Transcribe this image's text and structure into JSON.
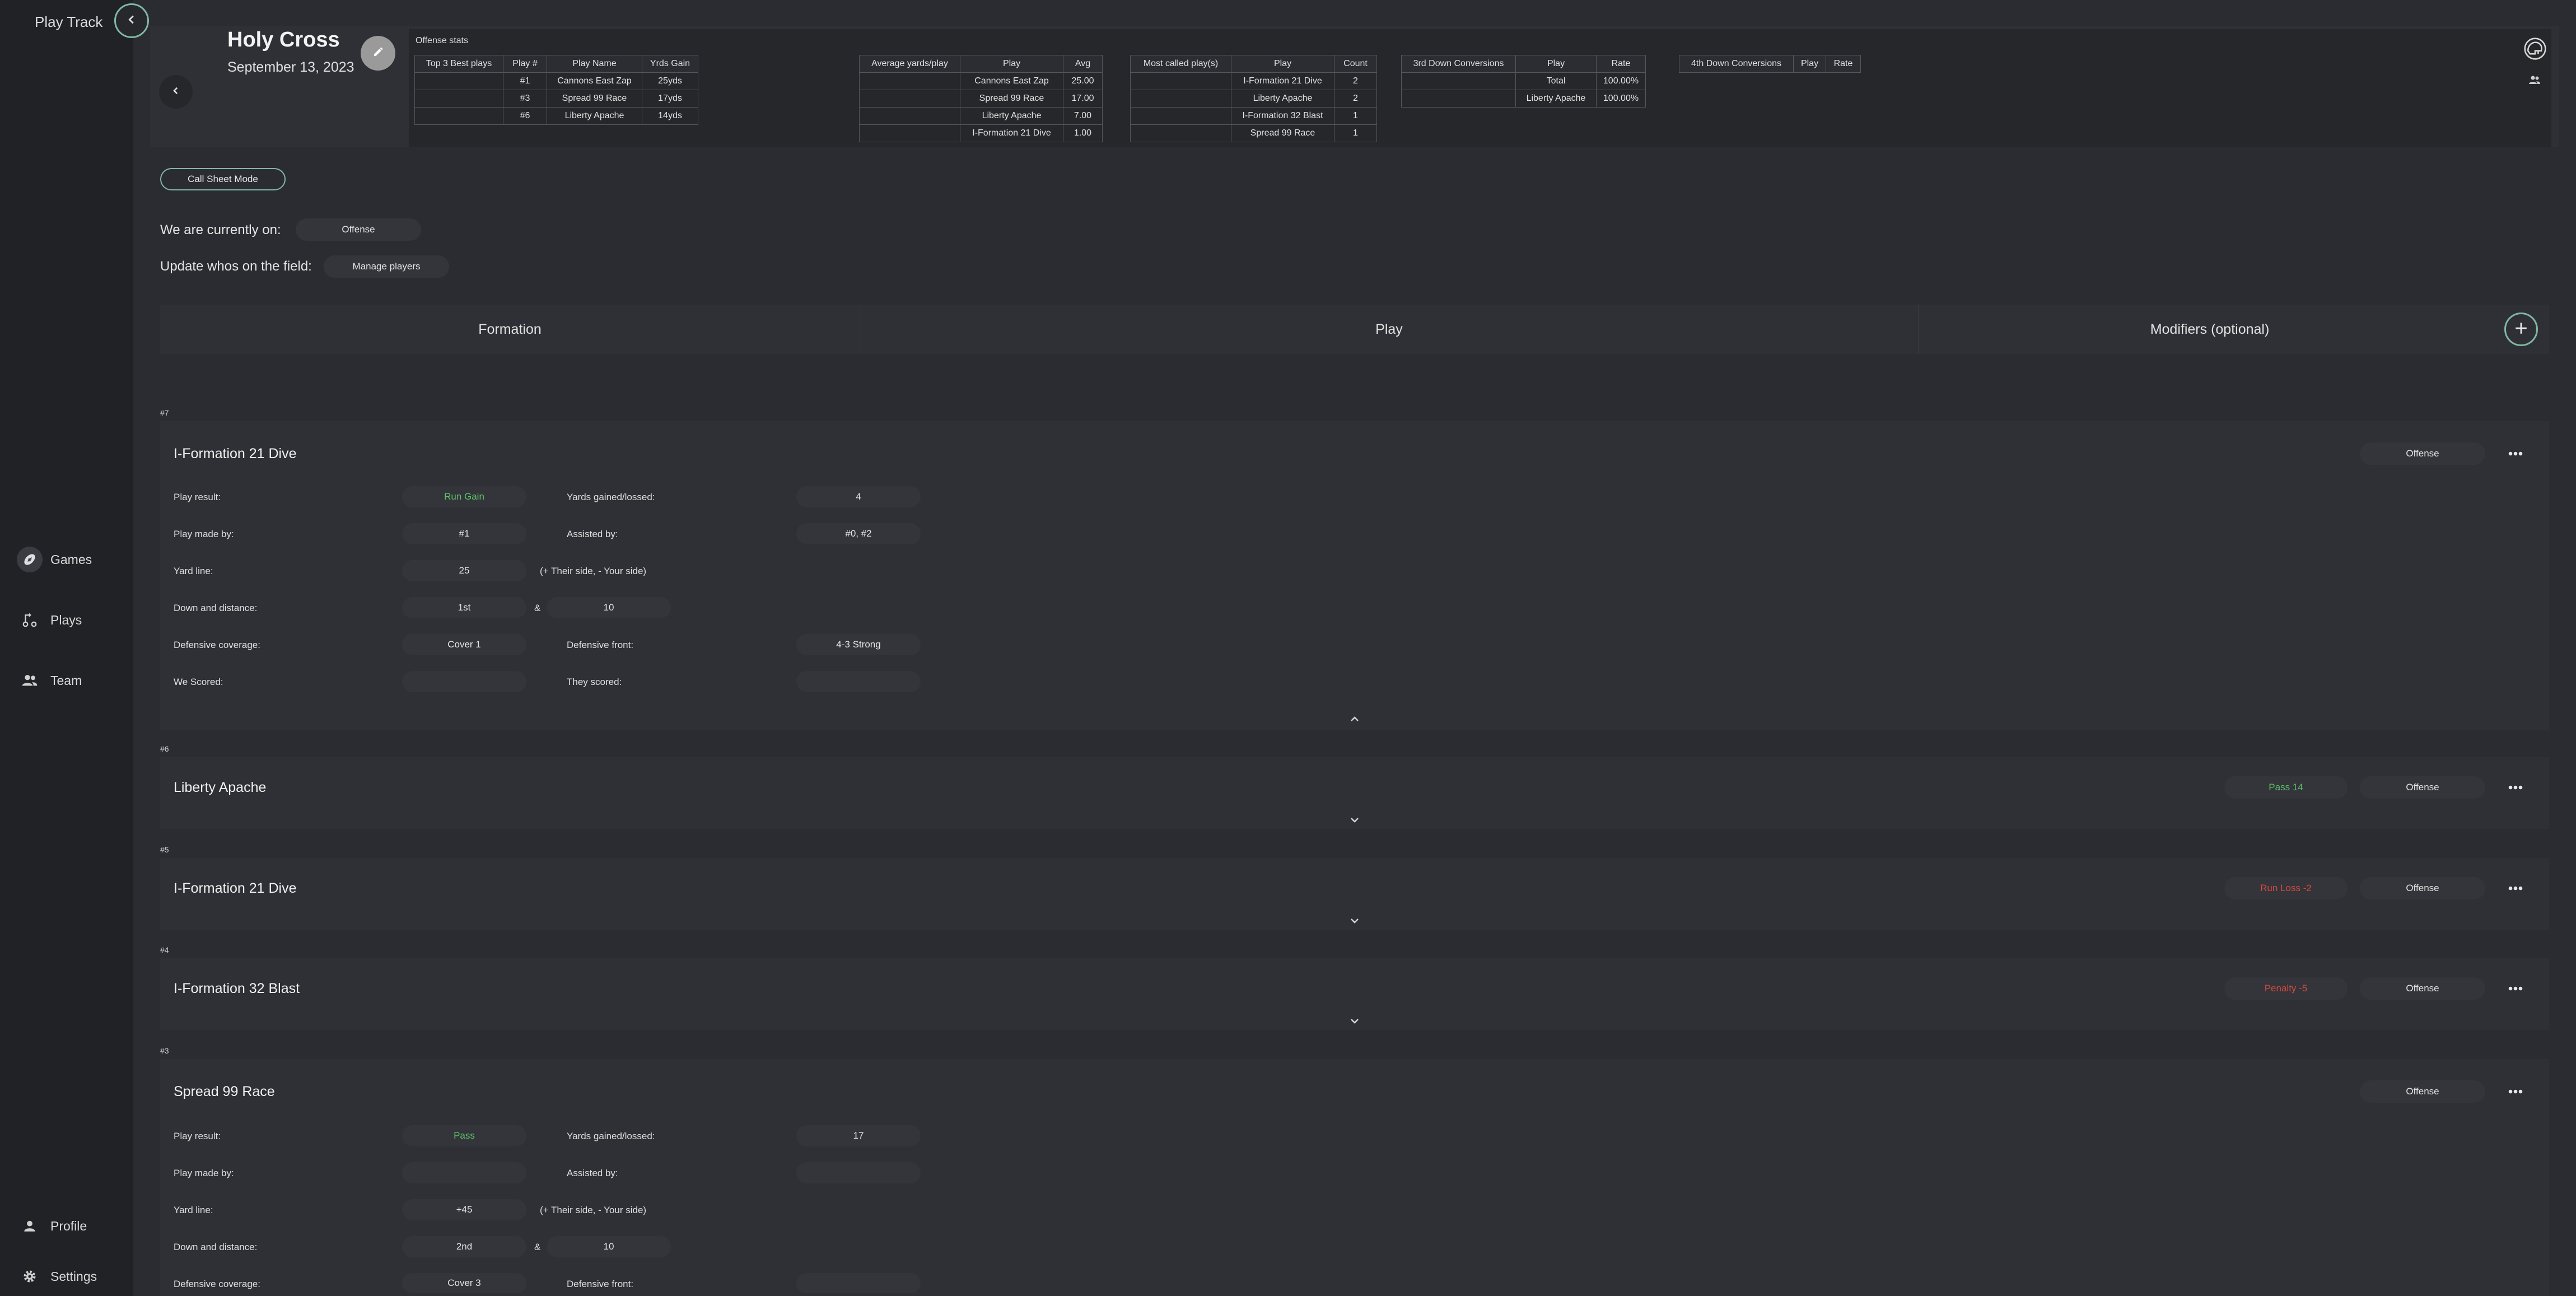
{
  "app": {
    "title": "Play Track"
  },
  "nav": {
    "games": "Games",
    "plays": "Plays",
    "team": "Team",
    "profile": "Profile",
    "settings": "Settings"
  },
  "game": {
    "title": "Holy Cross",
    "date": "September 13, 2023"
  },
  "stats": {
    "title": "Offense stats",
    "top3": {
      "headers": [
        "Top 3 Best plays",
        "Play #",
        "Play Name",
        "Yrds Gain"
      ],
      "rows": [
        [
          "",
          "#1",
          "Cannons East Zap",
          "25yds"
        ],
        [
          "",
          "#3",
          "Spread 99 Race",
          "17yds"
        ],
        [
          "",
          "#6",
          "Liberty Apache",
          "14yds"
        ]
      ]
    },
    "avg": {
      "headers": [
        "Average yards/play",
        "Play",
        "Avg"
      ],
      "rows": [
        [
          "",
          "Cannons East Zap",
          "25.00"
        ],
        [
          "",
          "Spread 99 Race",
          "17.00"
        ],
        [
          "",
          "Liberty Apache",
          "7.00"
        ],
        [
          "",
          "I-Formation 21 Dive",
          "1.00"
        ]
      ]
    },
    "most": {
      "headers": [
        "Most called play(s)",
        "Play",
        "Count"
      ],
      "rows": [
        [
          "",
          "I-Formation 21 Dive",
          "2"
        ],
        [
          "",
          "Liberty Apache",
          "2"
        ],
        [
          "",
          "I-Formation 32 Blast",
          "1"
        ],
        [
          "",
          "Spread 99 Race",
          "1"
        ]
      ]
    },
    "third": {
      "headers": [
        "3rd Down Conversions",
        "Play",
        "Rate"
      ],
      "rows": [
        [
          "",
          "Total",
          "100.00%"
        ],
        [
          "",
          "Liberty Apache",
          "100.00%"
        ]
      ]
    },
    "fourth": {
      "headers": [
        "4th Down Conversions",
        "Play",
        "Rate"
      ]
    }
  },
  "controls": {
    "call_sheet": "Call Sheet Mode",
    "currently_on_label": "We are currently on:",
    "currently_on_value": "Offense",
    "field_label": "Update whos on the field:",
    "manage_players": "Manage players"
  },
  "selector": {
    "formation": "Formation",
    "play": "Play",
    "modifiers": "Modifiers (optional)"
  },
  "labels": {
    "play_result": "Play result:",
    "yards": "Yards gained/lossed:",
    "made_by": "Play made by:",
    "assisted_by": "Assisted by:",
    "yard_line": "Yard line:",
    "yard_hint": "(+ Their side, - Your side)",
    "down_distance": "Down and distance:",
    "amp": "&",
    "coverage": "Defensive coverage:",
    "front": "Defensive front:",
    "we_scored": "We Scored:",
    "they_scored": "They scored:"
  },
  "plays": [
    {
      "num": "#7",
      "name": "I-Formation 21 Dive",
      "side": "Offense",
      "result": "Run Gain",
      "result_color": "#5cc46a",
      "yards": "4",
      "made_by": "#1",
      "assisted": "#0, #2",
      "yard_line": "25",
      "down": "1st",
      "distance": "10",
      "coverage": "Cover 1",
      "front": "4-3 Strong",
      "we_scored": "",
      "they_scored": ""
    },
    {
      "num": "#6",
      "name": "Liberty Apache",
      "side": "Offense",
      "summary": "Pass 14",
      "summary_color": "#5cc46a"
    },
    {
      "num": "#5",
      "name": "I-Formation 21 Dive",
      "side": "Offense",
      "summary": "Run Loss -2",
      "summary_color": "#d3493f"
    },
    {
      "num": "#4",
      "name": "I-Formation 32 Blast",
      "side": "Offense",
      "summary": "Penalty -5",
      "summary_color": "#d3493f"
    },
    {
      "num": "#3",
      "name": "Spread 99 Race",
      "side": "Offense",
      "result": "Pass",
      "result_color": "#5cc46a",
      "yards": "17",
      "made_by": "",
      "assisted": "",
      "yard_line": "+45",
      "down": "2nd",
      "distance": "10",
      "coverage": "Cover 3",
      "front": ""
    }
  ]
}
